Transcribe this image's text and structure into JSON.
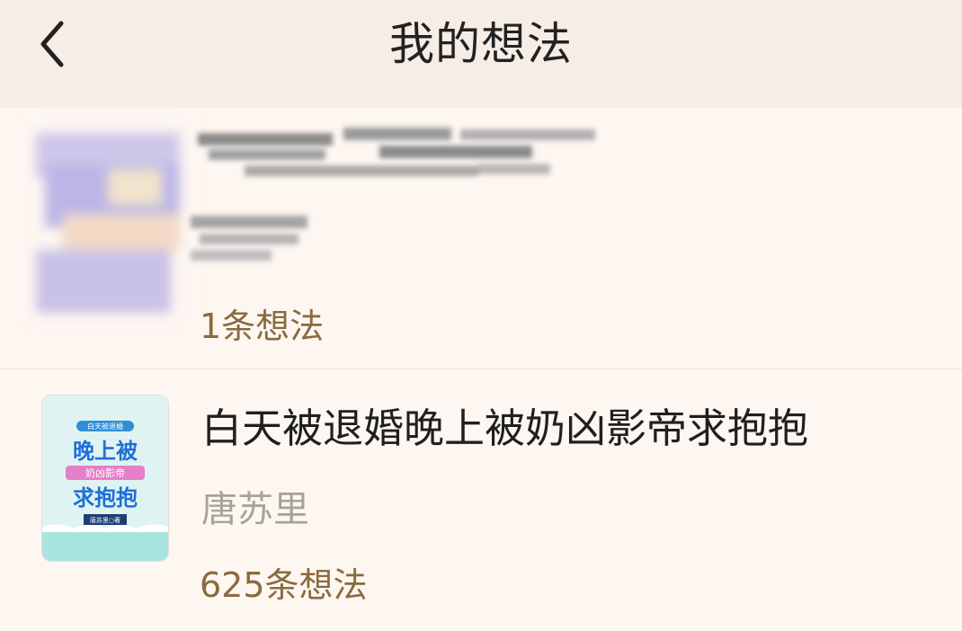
{
  "header": {
    "title": "我的想法",
    "back_icon": "chevron-left-icon"
  },
  "items": [
    {
      "thought_count": "1条想法"
    },
    {
      "book_title": "白天被退婚晚上被奶凶影帝求抱抱",
      "author": "唐苏里",
      "thought_count": "625条想法",
      "cover_text": {
        "top_line": "白天被退婚",
        "big_line1": "晚上被",
        "small_line": "奶凶影帝",
        "big_line2": "求抱抱",
        "author_line": "唐苏里○著"
      }
    }
  ],
  "colors": {
    "background": "#fdf6f1",
    "header_bg": "#f6ede6",
    "count_text": "#8a6a3e",
    "author_text": "#a8a29d"
  }
}
